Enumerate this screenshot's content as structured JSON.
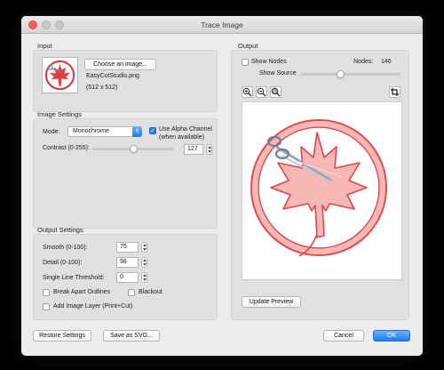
{
  "window": {
    "title": "Trace Image"
  },
  "input": {
    "section_label": "Input",
    "choose_label": "Choose an image...",
    "filename": "EasyCutStudio.png",
    "dimensions": "(512 x 512)"
  },
  "image_settings": {
    "section_label": "Image Settings",
    "mode_label": "Mode:",
    "mode_value": "Monochrome",
    "alpha_label": "Use Alpha Channel",
    "alpha_sub": "(when available)",
    "alpha_checked": true,
    "contrast_label": "Contrast (0-255):",
    "contrast_value": "127",
    "contrast_level": 0.5
  },
  "output_settings": {
    "section_label": "Output Settings",
    "smooth_label": "Smooth (0-100):",
    "smooth_value": "75",
    "detail_label": "Detail (0-100):",
    "detail_value": "98",
    "threshold_label": "Single Line Threshold:",
    "threshold_value": "0",
    "break_apart_label": "Break Apart Outlines",
    "blackout_label": "Blackout",
    "add_image_label": "Add Image Layer (Print+Cut)"
  },
  "output": {
    "section_label": "Output",
    "show_nodes_label": "Show Nodes",
    "nodes_label": "Nodes:",
    "nodes_value": "146",
    "show_source_label": "Show Source",
    "show_source_level": 0.37,
    "update_preview_label": "Update Preview"
  },
  "footer": {
    "restore_label": "Restore Settings",
    "save_svg_label": "Save as SVG...",
    "cancel_label": "Cancel",
    "ok_label": "OK"
  },
  "colors": {
    "accent": "#1b7cf2",
    "trace_red": "#e8434a",
    "trace_pink": "#f6b8b4"
  },
  "icons": [
    "zoom-in-icon",
    "zoom-out-icon",
    "zoom-fit-icon",
    "crop-icon",
    "maple-leaf-scissors-icon"
  ]
}
